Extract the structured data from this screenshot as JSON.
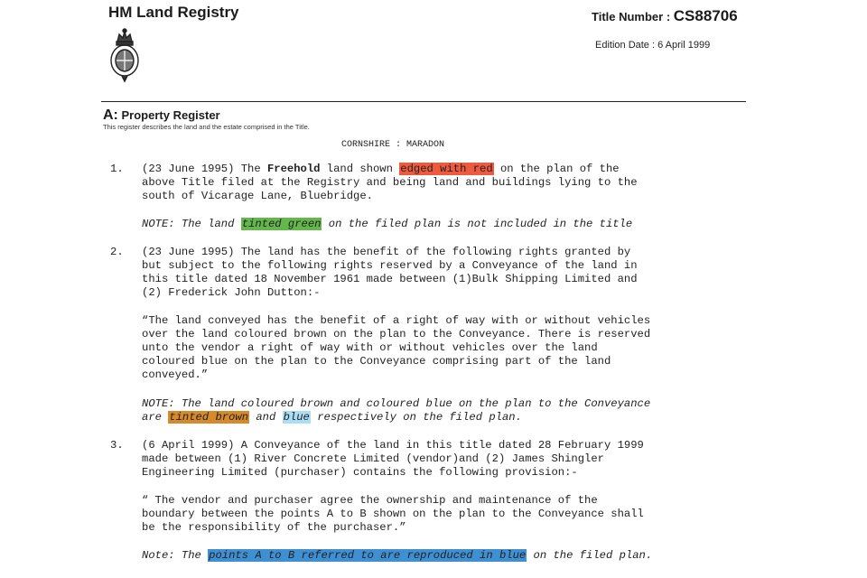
{
  "header": {
    "org_name": "HM Land Registry",
    "crest_icon": "royal-crest-icon",
    "title_number_label": "Title Number : ",
    "title_number": "CS88706",
    "edition_date": "Edition Date : 6 April 1999"
  },
  "section": {
    "letter": "A:",
    "title": "Property Register",
    "description": "This register describes the land and the estate comprised in the Title."
  },
  "county_line": "CORNSHIRE : MARADON",
  "highlight_colors": {
    "red": "#ee5a3f",
    "green": "#63b74b",
    "brown": "#d58a2c",
    "light_blue": "#a9def5",
    "blue": "#3f8fd3"
  },
  "entries": [
    {
      "number": "1.",
      "l1_a": "(23 June 1995) The ",
      "l1_bold": "Freehold",
      "l1_b": " land shown ",
      "l1_hl": "edged with red",
      "l1_c": " on the plan of the",
      "l2": "above Title filed at the Registry and being land and buildings lying to the",
      "l3": "south of Vicarage Lane, Bluebridge.",
      "note_a": "NOTE: The land ",
      "note_hl": "tinted green",
      "note_b": " on the filed plan is not included in the title"
    },
    {
      "number": "2.",
      "l1": "(23 June 1995) The land has the benefit of the following rights granted by",
      "l2": "but subject to the following rights reserved by a Conveyance of the land in",
      "l3": "this title dated 18 November 1961 made between (1)Bulk Shipping Limited and",
      "l4": "(2) Frederick John Dutton:-",
      "q1": "“The land conveyed has the benefit of a right of way with or without vehicles",
      "q2": "over the land coloured brown on the plan to the Conveyance. There is reserved",
      "q3": "unto the vendor a right of way with or without vehicles over the land",
      "q4": "coloured blue on the plan to the Conveyance comprising part of the land",
      "q5": "conveyed.”",
      "note_l1": "NOTE: The land coloured brown and coloured blue on the plan to the Conveyance",
      "note_l2_a": "are ",
      "note_l2_hl1": "tinted brown",
      "note_l2_b": " and ",
      "note_l2_hl2": "blue",
      "note_l2_c": " respectively on the filed plan."
    },
    {
      "number": "3.",
      "l1": "(6 April 1999) A Conveyance of the land in this title dated 28 February 1999",
      "l2": "made between (1) River Concrete Limited (vendor)and (2) James Shingler",
      "l3": "Engineering Limited (purchaser) contains the following provision:-",
      "q1": "“ The vendor and purchaser agree the ownership and maintenance of the",
      "q2": "boundary between the points A to B shown on the plan to the Conveyance shall",
      "q3": "be the responsibility of the purchaser.”",
      "note_a": "Note: The ",
      "note_hl": "points A to B referred to are reproduced in blue",
      "note_b": " on the filed plan."
    }
  ]
}
